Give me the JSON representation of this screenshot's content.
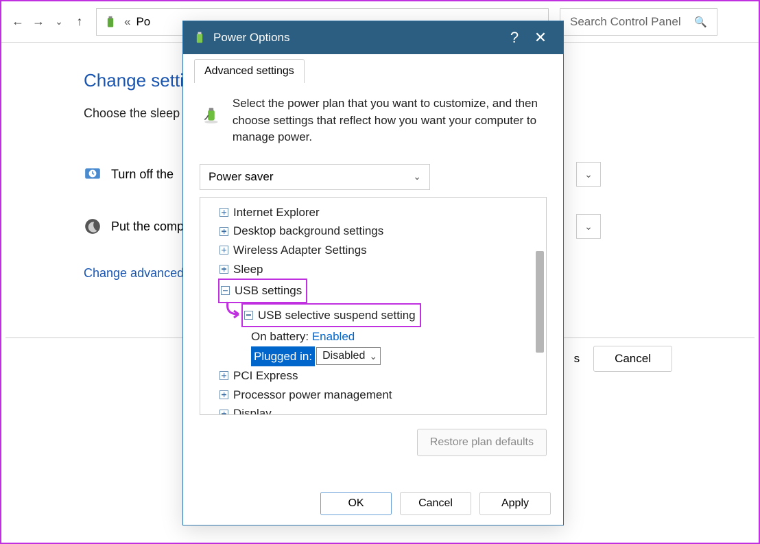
{
  "nav": {
    "breadcrumb_marker": "«",
    "breadcrumb_text": "Po",
    "search_placeholder": "Search Control Panel"
  },
  "page": {
    "title_visible": "Change setti",
    "subtitle_visible": "Choose the sleep",
    "row1_label": "Turn off the ",
    "row2_label": "Put the comp",
    "link_visible": "Change advanced",
    "cancel": "Cancel"
  },
  "dialog": {
    "title": "Power Options",
    "help": "?",
    "close": "✕",
    "tab": "Advanced settings",
    "instructions": "Select the power plan that you want to customize, and then choose settings that reflect how you want your computer to manage power.",
    "plan_selected": "Power saver",
    "tree": {
      "internet_explorer": "Internet Explorer",
      "desktop_bg": "Desktop background settings",
      "wireless": "Wireless Adapter Settings",
      "sleep": "Sleep",
      "usb_settings": "USB settings",
      "usb_suspend": "USB selective suspend setting",
      "on_battery_label": "On battery:",
      "on_battery_value": "Enabled",
      "plugged_in_label": "Plugged in:",
      "plugged_in_value": "Disabled",
      "pci": "PCI Express",
      "processor": "Processor power management",
      "display": "Display"
    },
    "restore": "Restore plan defaults",
    "ok": "OK",
    "cancel": "Cancel",
    "apply": "Apply"
  }
}
